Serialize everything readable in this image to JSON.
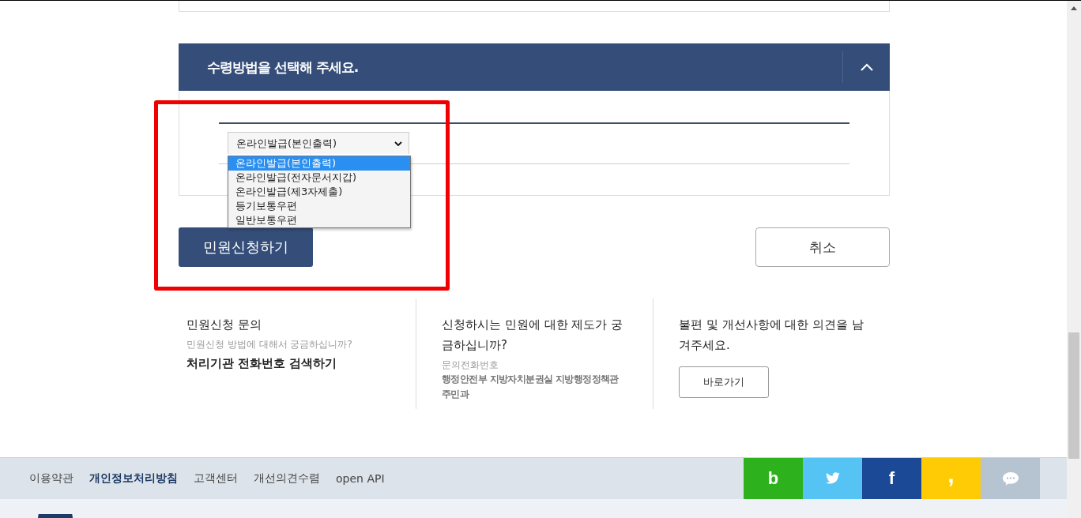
{
  "receive_section": {
    "title": "수령방법을 선택해 주세요.",
    "expanded": true,
    "select": {
      "value": "온라인발급(본인출력)",
      "open": true,
      "options": [
        {
          "label": "온라인발급(본인출력)",
          "selected": true
        },
        {
          "label": "온라인발급(전자문서지갑)",
          "selected": false
        },
        {
          "label": "온라인발급(제3자제출)",
          "selected": false
        },
        {
          "label": "등기보통우편",
          "selected": false
        },
        {
          "label": "일반보통우편",
          "selected": false
        }
      ]
    }
  },
  "buttons": {
    "submit": "민원신청하기",
    "cancel": "취소"
  },
  "info": [
    {
      "title": "민원신청 문의",
      "sub": "민원신청 방법에 대해서 궁금하십니까?",
      "kind": "link",
      "link": "처리기관 전화번호 검색하기"
    },
    {
      "title": "신청하시는 민원에 대한 제도가 궁금하십니까?",
      "sub": "문의전화번호",
      "kind": "contact",
      "contact": "행정안전부 지방자치분권실 지방행정정책관 주민과"
    },
    {
      "title": "불편 및 개선사항에 대한 의견을 남겨주세요.",
      "kind": "button",
      "button": "바로가기"
    }
  ],
  "footer": {
    "links": [
      {
        "label": "이용약관",
        "emphasized": false
      },
      {
        "label": "개인정보처리방침",
        "emphasized": true
      },
      {
        "label": "고객센터",
        "emphasized": false
      },
      {
        "label": "개선의견수렴",
        "emphasized": false
      },
      {
        "label": "open API",
        "emphasized": false
      }
    ],
    "social": [
      {
        "kind": "letter",
        "glyph": "b",
        "color": "#2db21d"
      },
      {
        "kind": "bird",
        "color": "#55c4f4"
      },
      {
        "kind": "letter",
        "glyph": "f",
        "color": "#1c4996"
      },
      {
        "kind": "letter",
        "glyph": ",",
        "color": "#ffcb05"
      },
      {
        "kind": "bubble",
        "color": "#b6c3d0"
      }
    ]
  }
}
